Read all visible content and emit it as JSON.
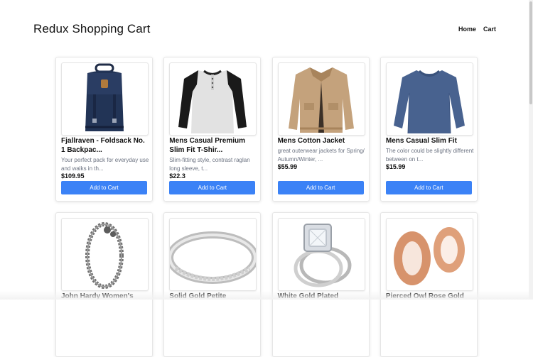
{
  "header": {
    "title": "Redux Shopping Cart",
    "nav": [
      "Home",
      "Cart"
    ]
  },
  "products": [
    {
      "title": "Fjallraven - Foldsack No. 1 Backpac...",
      "description": "Your perfect pack for everyday use and walks in th...",
      "price": "$109.95",
      "button": "Add to Cart",
      "image": "backpack"
    },
    {
      "title": "Mens Casual Premium Slim Fit T-Shir...",
      "description": "Slim-fitting style, contrast raglan long sleeve, t...",
      "price": "$22.3",
      "button": "Add to Cart",
      "image": "raglan-shirt"
    },
    {
      "title": "Mens Cotton Jacket",
      "description": "great outerwear jackets for Spring/ Autumn/Winter, ...",
      "price": "$55.99",
      "button": "Add to Cart",
      "image": "jacket"
    },
    {
      "title": "Mens Casual Slim Fit",
      "description": "The color could be slightly different between on t...",
      "price": "$15.99",
      "button": "Add to Cart",
      "image": "long-sleeve"
    },
    {
      "title": "John Hardy Women's",
      "image": "bracelet"
    },
    {
      "title": "Solid Gold Petite",
      "image": "ring-band"
    },
    {
      "title": "White Gold Plated",
      "image": "diamond-ring"
    },
    {
      "title": "Pierced Owl Rose Gold",
      "image": "rose-gold-plugs"
    }
  ],
  "colors": {
    "button": "#3b82f6",
    "description": "#6b7280"
  }
}
